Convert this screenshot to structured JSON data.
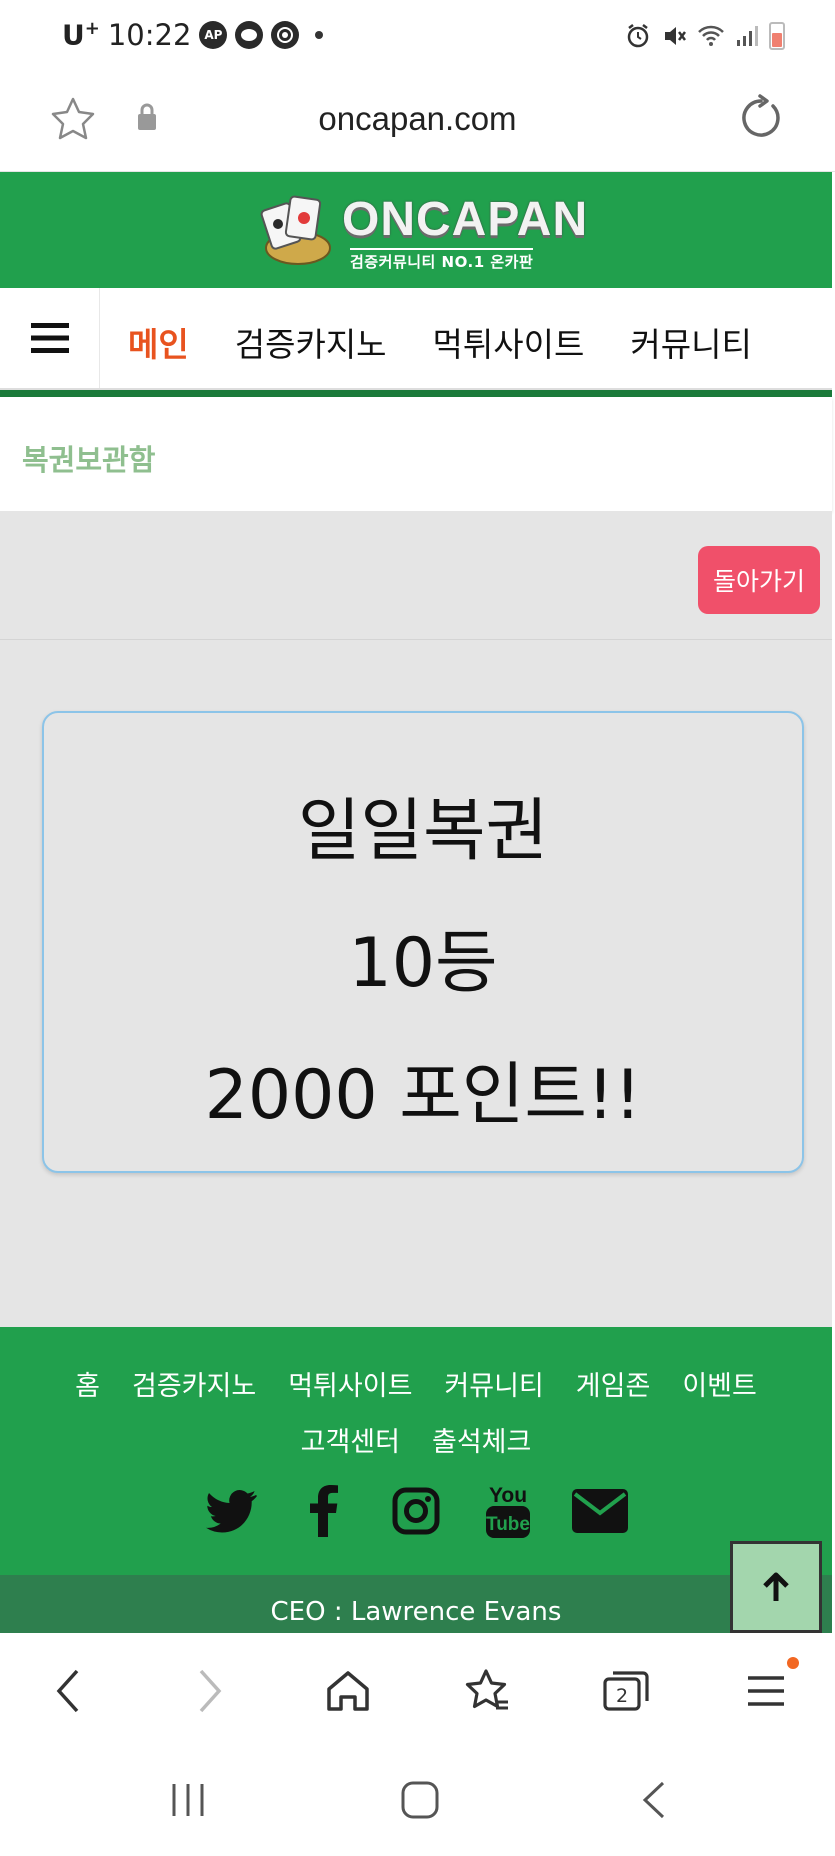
{
  "status_bar": {
    "carrier": "U",
    "carrier_sup": "+",
    "time": "10:22",
    "app_icon_1": "AP",
    "icons": [
      "alarm-icon",
      "mute-icon",
      "wifi-icon",
      "signal-icon",
      "battery-icon"
    ]
  },
  "browser": {
    "url": "oncapan.com"
  },
  "site": {
    "logo_title": "ONCAPAN",
    "logo_subtitle": "검증커뮤니티 NO.1 온카판",
    "brand_color": "#21a04d",
    "nav_items": [
      {
        "label": "메인"
      },
      {
        "label": "검증카지노"
      },
      {
        "label": "먹튀사이트"
      },
      {
        "label": "커뮤니티"
      }
    ],
    "breadcrumb_title": "복권보관함",
    "back_button": "돌아가기",
    "prize": {
      "line1": "일일복권",
      "line2": "10등",
      "line3": "2000 포인트!!"
    }
  },
  "footer": {
    "links": [
      "홈",
      "검증카지노",
      "먹튀사이트",
      "커뮤니티",
      "게임존",
      "이벤트",
      "고객센터",
      "출석체크"
    ],
    "social": [
      "twitter-icon",
      "facebook-icon",
      "instagram-icon",
      "youtube-icon",
      "email-icon"
    ],
    "ceo": "CEO : Lawrence Evans"
  },
  "browser_toolbar": {
    "tabs_count": "2"
  }
}
